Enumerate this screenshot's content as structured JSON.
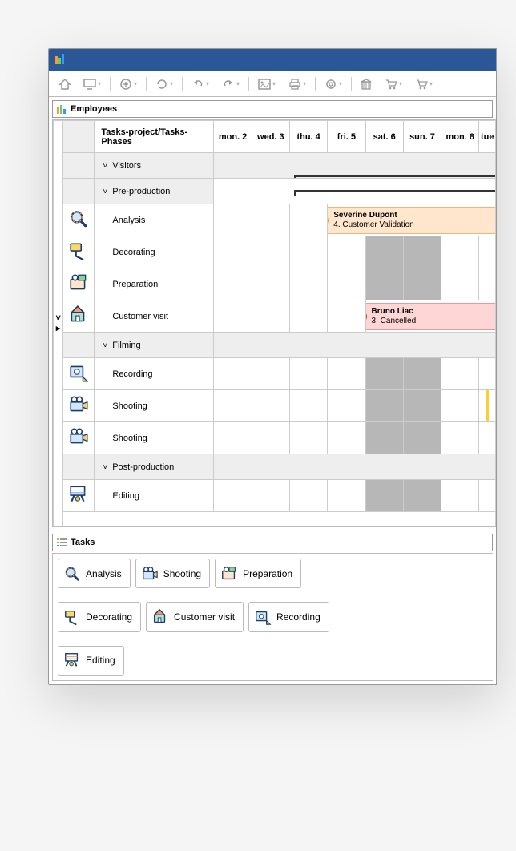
{
  "panels": {
    "employees": "Employees",
    "tasks": "Tasks"
  },
  "columns": {
    "header": "Tasks-project/Tasks-Phases",
    "days": [
      "mon. 2",
      "wed. 3",
      "thu. 4",
      "fri. 5",
      "sat. 6",
      "sun. 7",
      "mon. 8",
      "tue"
    ]
  },
  "groups": {
    "visitors": "Visitors",
    "preprod": "Pre-production",
    "filming": "Filming",
    "postprod": "Post-production"
  },
  "rows": {
    "analysis": "Analysis",
    "decorating": "Decorating",
    "preparation": "Preparation",
    "customer_visit": "Customer visit",
    "recording": "Recording",
    "shooting1": "Shooting",
    "shooting2": "Shooting",
    "editing": "Editing"
  },
  "events": {
    "severine": {
      "name": "Severine Dupont",
      "status": "4. Customer Validation"
    },
    "bruno": {
      "name": "Bruno Liac",
      "status": "3. Cancelled"
    }
  },
  "chips": {
    "analysis": "Analysis",
    "shooting": "Shooting",
    "preparation": "Preparation",
    "decorating": "Decorating",
    "customer_visit": "Customer visit",
    "recording": "Recording",
    "editing": "Editing"
  }
}
